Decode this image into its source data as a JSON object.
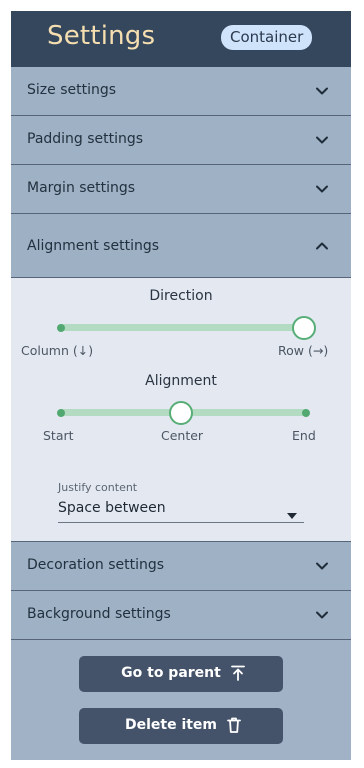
{
  "header": {
    "title": "Settings",
    "badge": "Container"
  },
  "sections": {
    "size": {
      "label": "Size settings",
      "expanded": false
    },
    "padding": {
      "label": "Padding settings",
      "expanded": false
    },
    "margin": {
      "label": "Margin settings",
      "expanded": false
    },
    "alignment": {
      "label": "Alignment settings",
      "expanded": true
    },
    "decoration": {
      "label": "Decoration settings",
      "expanded": false
    },
    "background": {
      "label": "Background settings",
      "expanded": false
    }
  },
  "alignment_panel": {
    "direction": {
      "title": "Direction",
      "options": [
        "Column (↓)",
        "Row (→)"
      ],
      "selected": "Row (→)"
    },
    "alignment": {
      "title": "Alignment",
      "options": [
        "Start",
        "Center",
        "End"
      ],
      "selected": "Center"
    },
    "justify": {
      "label": "Justify content",
      "value": "Space between"
    }
  },
  "buttons": {
    "go_to_parent": {
      "label": "Go to parent",
      "icon": "arrow-up-to-line-icon"
    },
    "delete_item": {
      "label": "Delete item",
      "icon": "trash-icon"
    }
  },
  "colors": {
    "header_bg": "#34475d",
    "title": "#f5deb0",
    "badge_bg": "#cfe3fb",
    "panel_bg": "#a1b2c6",
    "expanded_bg": "#e4e9f1",
    "slider_track": "#b3dbc1",
    "slider_accent": "#52a871",
    "button_bg": "#44536a"
  }
}
